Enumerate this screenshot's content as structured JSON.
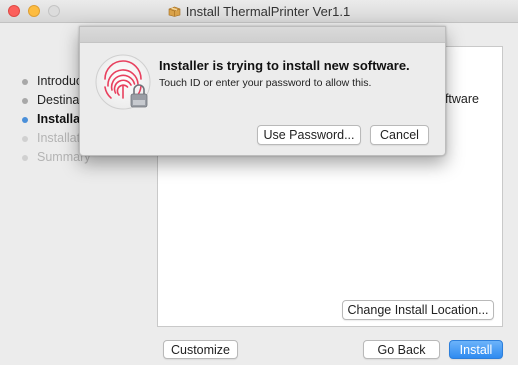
{
  "window": {
    "title": "Install ThermalPrinter Ver1.1"
  },
  "steps": [
    {
      "label": "Introduc",
      "state": "done"
    },
    {
      "label": "Destinat",
      "state": "done"
    },
    {
      "label": "Installat",
      "state": "active"
    },
    {
      "label": "Installati",
      "state": "future"
    },
    {
      "label": "Summary",
      "state": "future"
    }
  ],
  "content": {
    "partial_text": "oftware"
  },
  "buttons": {
    "change_location": "Change Install Location...",
    "customize": "Customize",
    "go_back": "Go Back",
    "install": "Install"
  },
  "dialog": {
    "title": "Installer is trying to install new software.",
    "subtitle": "Touch ID or enter your password to allow this.",
    "use_password": "Use Password...",
    "cancel": "Cancel",
    "icon": "fingerprint-lock-icon"
  },
  "colors": {
    "accent": "#3d8ff0",
    "fingerprint": "#e8405e",
    "close": "#fc605c",
    "minimize": "#fdbc40",
    "zoom": "#dcdcdc"
  }
}
